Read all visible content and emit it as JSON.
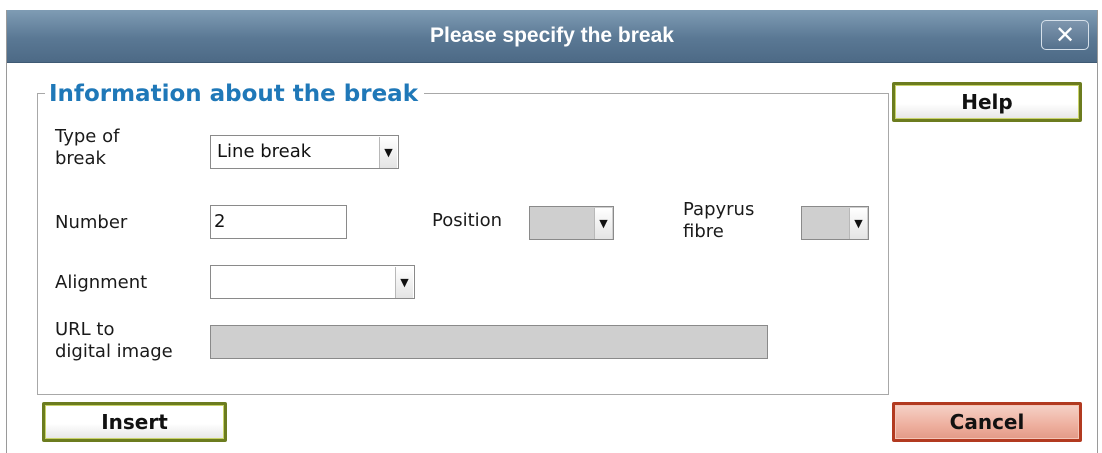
{
  "dialog": {
    "title": "Please specify the break",
    "close_label": "✕"
  },
  "section": {
    "legend": "Information about the break"
  },
  "fields": {
    "type_of_break": {
      "label_line1": "Type of",
      "label_line2": "break",
      "value": "Line break"
    },
    "number": {
      "label": "Number",
      "value": "2"
    },
    "position": {
      "label": "Position",
      "value": ""
    },
    "papyrus_fibre": {
      "label_line1": "Papyrus",
      "label_line2": "fibre",
      "value": ""
    },
    "alignment": {
      "label": "Alignment",
      "value": ""
    },
    "url": {
      "label_line1": "URL to",
      "label_line2": "digital image",
      "value": ""
    }
  },
  "buttons": {
    "help": "Help",
    "insert": "Insert",
    "cancel": "Cancel"
  },
  "icons": {
    "close": "close-icon",
    "dropdown": "triangle-down-icon"
  },
  "colors": {
    "titlebar": "#5a7894",
    "legend": "#1f78b8",
    "ok_button_border": "#6c7c1f",
    "cancel_button_border": "#b23a20"
  }
}
